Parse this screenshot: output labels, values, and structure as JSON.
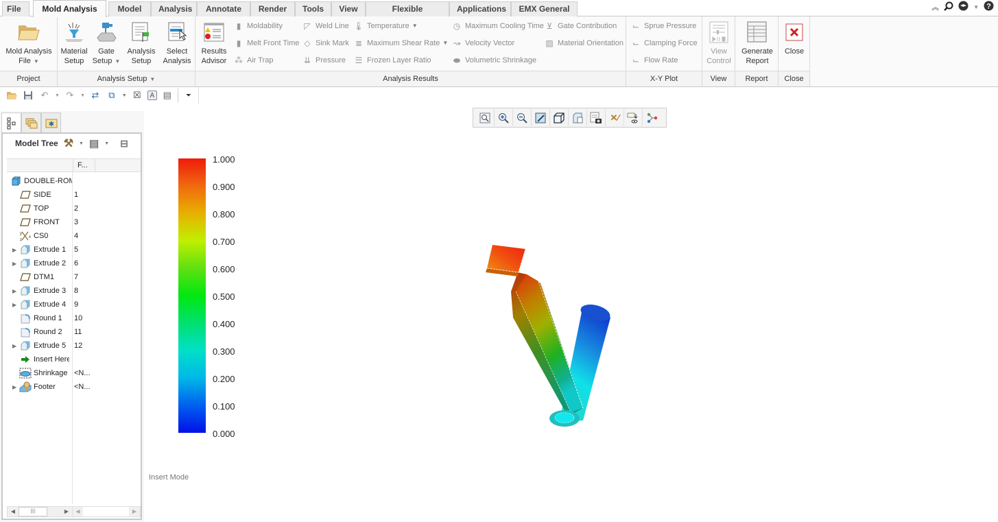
{
  "tabs": {
    "file": "File",
    "items": [
      "Mold Analysis",
      "Model",
      "Analysis",
      "Annotate",
      "Render",
      "Tools",
      "View",
      "Flexible Modeling",
      "Applications",
      "EMX General"
    ],
    "active": "Mold Analysis"
  },
  "top_icons": [
    "collapse-ribbon-icon",
    "search-icon",
    "learning-connector-icon",
    "dropdown-icon",
    "help-icon"
  ],
  "ribbon": {
    "groups": {
      "project": "Project",
      "analysis_setup": "Analysis Setup",
      "analysis_results": "Analysis Results",
      "xy_plot": "X-Y Plot",
      "view": "View",
      "report": "Report",
      "close": "Close"
    },
    "project": {
      "mold_analysis_file": [
        "Mold Analysis",
        "File"
      ]
    },
    "setup": {
      "material": [
        "Material",
        "Setup"
      ],
      "gate": [
        "Gate",
        "Setup"
      ],
      "analysis": [
        "Analysis",
        "Setup"
      ],
      "select": [
        "Select",
        "Analysis"
      ]
    },
    "results": {
      "advisor": [
        "Results",
        "Advisor"
      ],
      "moldability": "Moldability",
      "melt_front_time": "Melt Front Time",
      "air_trap": "Air Trap",
      "weld_line": "Weld Line",
      "sink_mark": "Sink Mark",
      "pressure": "Pressure",
      "temperature": "Temperature",
      "max_shear_rate": "Maximum Shear Rate",
      "frozen_layer_ratio": "Frozen Layer Ratio",
      "max_cooling_time": "Maximum Cooling Time",
      "velocity_vector": "Velocity Vector",
      "volumetric_shrinkage": "Volumetric Shrinkage",
      "gate_contribution": "Gate Contribution",
      "material_orientation": "Material Orientation"
    },
    "xy": {
      "sprue_pressure": "Sprue Pressure",
      "clamping_force": "Clamping Force",
      "flow_rate": "Flow Rate"
    },
    "view_control": [
      "View",
      "Control"
    ],
    "generate_report": [
      "Generate",
      "Report"
    ],
    "close": "Close"
  },
  "quick_access": [
    "open-icon",
    "save-icon",
    "undo-icon",
    "redo-icon",
    "regenerate-icon",
    "windows-icon",
    "close-window-icon",
    "annotation-icon",
    "properties-icon",
    "customize-icon"
  ],
  "panel": {
    "tabs": [
      "model-tree-tab",
      "folder-browser-tab",
      "favorites-tab"
    ],
    "title": "Model Tree",
    "col_header": "F...",
    "rows": [
      {
        "name": "DOUBLE-ROM/",
        "num": "",
        "icon": "part",
        "expandable": false,
        "indent": 0
      },
      {
        "name": "SIDE",
        "num": "1",
        "icon": "datum-plane",
        "expandable": false,
        "indent": 1
      },
      {
        "name": "TOP",
        "num": "2",
        "icon": "datum-plane",
        "expandable": false,
        "indent": 1
      },
      {
        "name": "FRONT",
        "num": "3",
        "icon": "datum-plane",
        "expandable": false,
        "indent": 1
      },
      {
        "name": "CS0",
        "num": "4",
        "icon": "csys",
        "expandable": false,
        "indent": 1
      },
      {
        "name": "Extrude 1",
        "num": "5",
        "icon": "extrude",
        "expandable": true,
        "indent": 1
      },
      {
        "name": "Extrude 2",
        "num": "6",
        "icon": "extrude",
        "expandable": true,
        "indent": 1
      },
      {
        "name": "DTM1",
        "num": "7",
        "icon": "datum-plane",
        "expandable": false,
        "indent": 1
      },
      {
        "name": "Extrude 3",
        "num": "8",
        "icon": "extrude",
        "expandable": true,
        "indent": 1
      },
      {
        "name": "Extrude 4",
        "num": "9",
        "icon": "extrude",
        "expandable": true,
        "indent": 1
      },
      {
        "name": "Round 1",
        "num": "10",
        "icon": "round",
        "expandable": false,
        "indent": 1
      },
      {
        "name": "Round 2",
        "num": "11",
        "icon": "round",
        "expandable": false,
        "indent": 1
      },
      {
        "name": "Extrude 5",
        "num": "12",
        "icon": "extrude",
        "expandable": true,
        "indent": 1
      },
      {
        "name": "Insert Here",
        "num": "",
        "icon": "insert-arrow",
        "expandable": false,
        "indent": 1
      },
      {
        "name": "Shrinkage",
        "num": "<N...",
        "icon": "shrinkage",
        "expandable": false,
        "indent": 1
      },
      {
        "name": "Footer",
        "num": "<N...",
        "icon": "footer",
        "expandable": true,
        "indent": 1
      }
    ]
  },
  "graphics_toolbar": [
    "refit-icon",
    "zoom-in-icon",
    "zoom-out-icon",
    "repaint-icon",
    "display-style-icon",
    "saved-orientations-icon",
    "view-manager-icon",
    "datum-display-icon",
    "annotation-display-icon",
    "spin-center-icon"
  ],
  "legend": {
    "labels": [
      "1.000",
      "0.900",
      "0.800",
      "0.700",
      "0.600",
      "0.500",
      "0.400",
      "0.300",
      "0.200",
      "0.100",
      "0.000"
    ],
    "min": 0.0,
    "max": 1.0
  },
  "status": {
    "mode": "Insert Mode"
  }
}
